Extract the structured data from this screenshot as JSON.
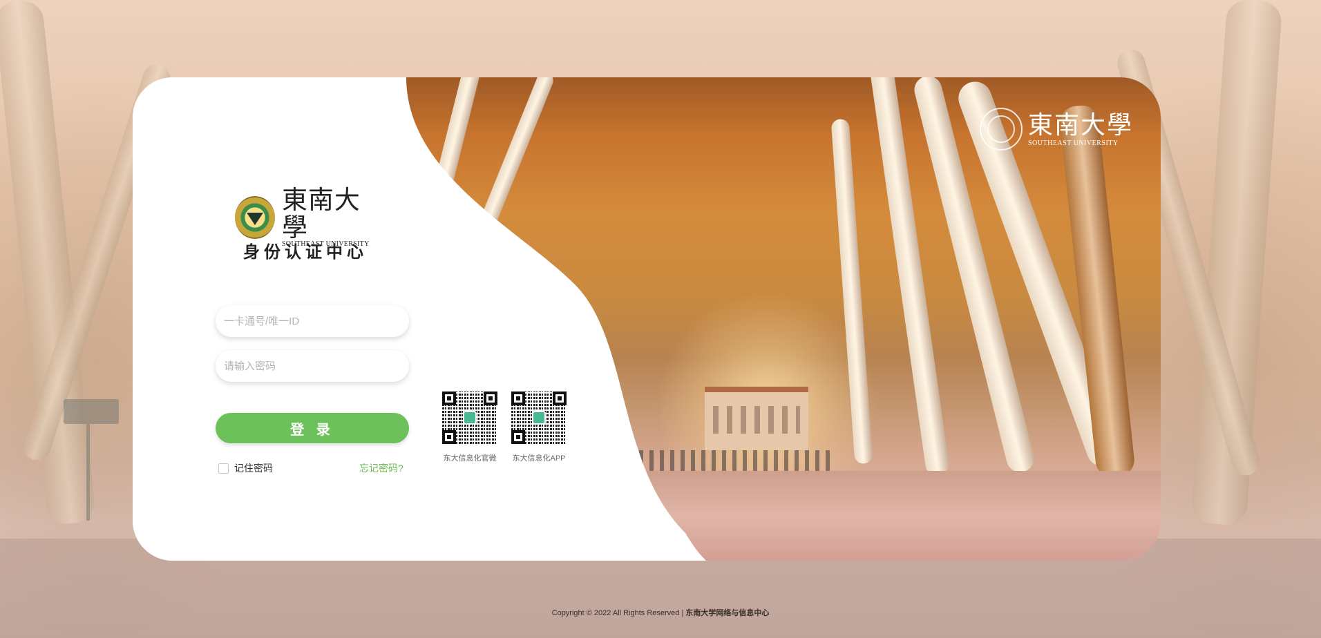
{
  "header": {
    "logo_cn": "東南大學",
    "logo_en": "SOUTHEAST UNIVERSITY",
    "title": "身份认证中心"
  },
  "form": {
    "username_placeholder": "一卡通号/唯一ID",
    "username_value": "",
    "password_placeholder": "请输入密码",
    "password_value": "",
    "login_label": "登 录",
    "remember_label": "记住密码",
    "remember_checked": false,
    "forgot_label": "忘记密码?"
  },
  "qr_codes": [
    {
      "label": "东大信息化官微"
    },
    {
      "label": "东大信息化APP"
    }
  ],
  "scene_logo": {
    "cn": "東南大學",
    "en": "SOUTHEAST UNIVERSITY"
  },
  "footer": {
    "copyright": "Copyright © 2022 All Rights Reserved | ",
    "org": "东南大学网络与信息中心"
  },
  "colors": {
    "accent": "#6dc15b",
    "link": "#6dbb52"
  }
}
